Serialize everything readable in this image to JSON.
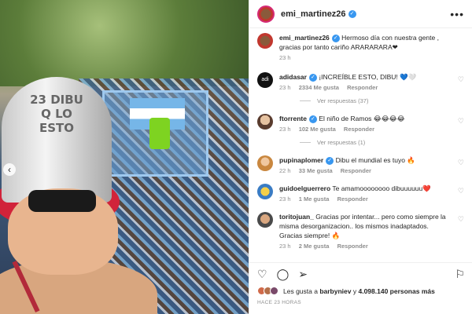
{
  "post": {
    "photo_hat_text": "23 DIBU Q LO ESTO",
    "author": "emi_martinez26"
  },
  "header": {
    "username": "emi_martinez26",
    "more_icon": "more-horizontal-icon"
  },
  "caption": {
    "username": "emi_martinez26",
    "text": "Hermoso día con nuestra gente , gracias por tanto cariño 🅰🆁🅰🆁🅰🆁🅰❤",
    "text_plain": "Hermoso día con nuestra gente , gracias por tanto cariño ARARARARA❤",
    "time": "23 h"
  },
  "comments": [
    {
      "username": "adidasar",
      "verified": true,
      "text": "¡INCREÍBLE ESTO, DIBU! 💙🤍",
      "time": "23 h",
      "likes": "2334 Me gusta",
      "reply": "Responder",
      "replies_label": "Ver respuestas (37)"
    },
    {
      "username": "ftorrente",
      "verified": true,
      "text": "El niño de Ramos 😂😂😂😂",
      "time": "23 h",
      "likes": "102 Me gusta",
      "reply": "Responder",
      "replies_label": "Ver respuestas (1)"
    },
    {
      "username": "pupinaplomer",
      "verified": true,
      "text": "Dibu el mundial es tuyo 🔥",
      "time": "22 h",
      "likes": "33 Me gusta",
      "reply": "Responder"
    },
    {
      "username": "guidoelguerrero",
      "verified": false,
      "text": "Te amamoooooooo dibuuuuuu❤️",
      "time": "23 h",
      "likes": "1 Me gusta",
      "reply": "Responder"
    },
    {
      "username": "toritojuan_",
      "verified": false,
      "text": "Gracias por intentar... pero como siempre la misma desorganizacion.. los mismos inadaptados. Gracias siempre! 🔥",
      "time": "23 h",
      "likes": "2 Me gusta",
      "reply": "Responder"
    }
  ],
  "actions": {
    "like_icon": "heart-icon",
    "comment_icon": "comment-icon",
    "share_icon": "send-icon",
    "save_icon": "bookmark-icon"
  },
  "likes": {
    "prefix": "Les gusta a",
    "user": "barbyniev",
    "joiner": "y",
    "count": "4.098.140 personas más"
  },
  "timestamp": "HACE 23 HORAS",
  "colors": {
    "verified": "#3897f0",
    "muted": "#8e8e8e",
    "text": "#262626"
  }
}
